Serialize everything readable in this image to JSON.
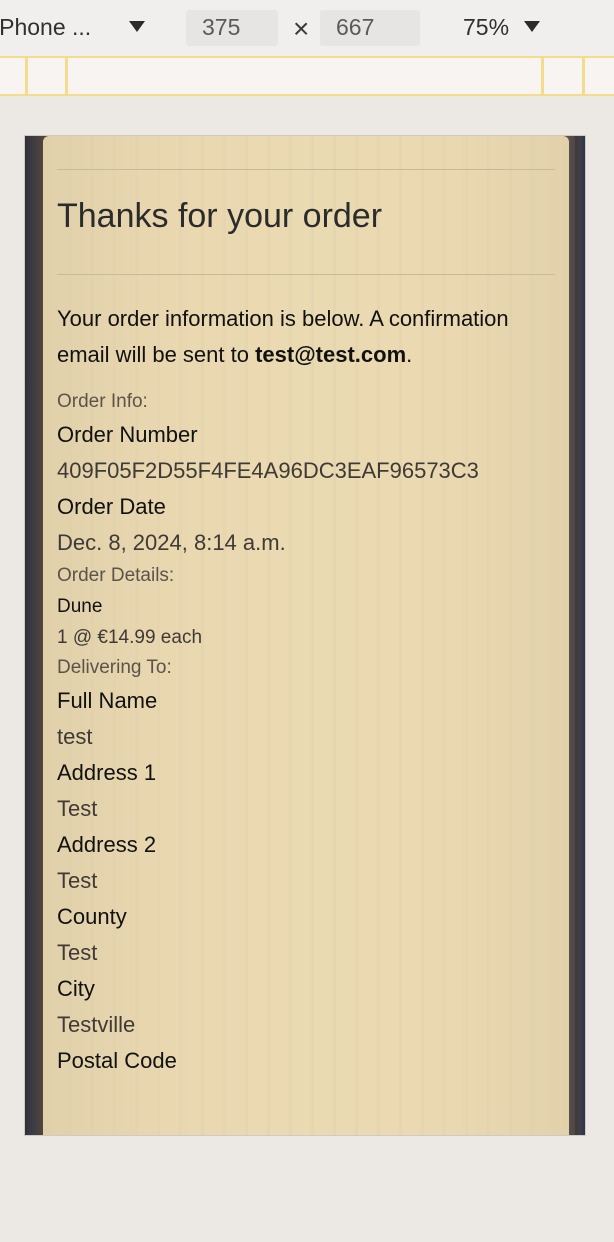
{
  "devtools": {
    "device": "iPhone ...",
    "width": "375",
    "times": "×",
    "height": "667",
    "zoom": "75%"
  },
  "page": {
    "title": "Thanks for your order",
    "intro_prefix": "Your order information is below. A confirmation email will be sent to ",
    "email": "test@test.com",
    "intro_suffix": ".",
    "order_info_heading": "Order Info:",
    "order_number_label": "Order Number",
    "order_number": "409F05F2D55F4FE4A96DC3EAF96573C3",
    "order_date_label": "Order Date",
    "order_date": "Dec. 8, 2024, 8:14 a.m.",
    "order_details_heading": "Order Details:",
    "item_name": "Dune",
    "item_qty": "1 @ €14.99 each",
    "delivering_heading": "Delivering To:",
    "full_name_label": "Full Name",
    "full_name": "test",
    "address1_label": "Address 1",
    "address1": "Test",
    "address2_label": "Address 2",
    "address2": "Test",
    "county_label": "County",
    "county": "Test",
    "city_label": "City",
    "city": "Testville",
    "postal_label": "Postal Code"
  }
}
